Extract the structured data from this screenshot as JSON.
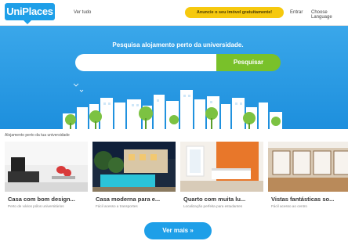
{
  "header": {
    "logo": "UniPlaces",
    "see_all": "Ver tudo",
    "cta": "Anuncie o seu imóvel gratuitamente!",
    "login": "Entrar",
    "language": "Choose Language"
  },
  "hero": {
    "title": "Pesquisa alojamento perto da universidade.",
    "search_value": "",
    "search_button": "Pesquisar"
  },
  "listings": {
    "caption": "Alojamento perto da tua universidade",
    "items": [
      {
        "title": "Casa com bom design...",
        "subtitle": "Perto de vários pólos universitários"
      },
      {
        "title": "Casa moderna para e...",
        "subtitle": "Fácil acesso a transportes"
      },
      {
        "title": "Quarto com muita lu...",
        "subtitle": "Localização perfeita para estudantes"
      },
      {
        "title": "Vistas fantásticas so...",
        "subtitle": "Fácil acesso ao centro"
      }
    ],
    "more_button": "Ver mais »"
  },
  "colors": {
    "brand_blue": "#1e9fe8",
    "cta_yellow": "#f6c90e",
    "search_green": "#79c12a"
  }
}
